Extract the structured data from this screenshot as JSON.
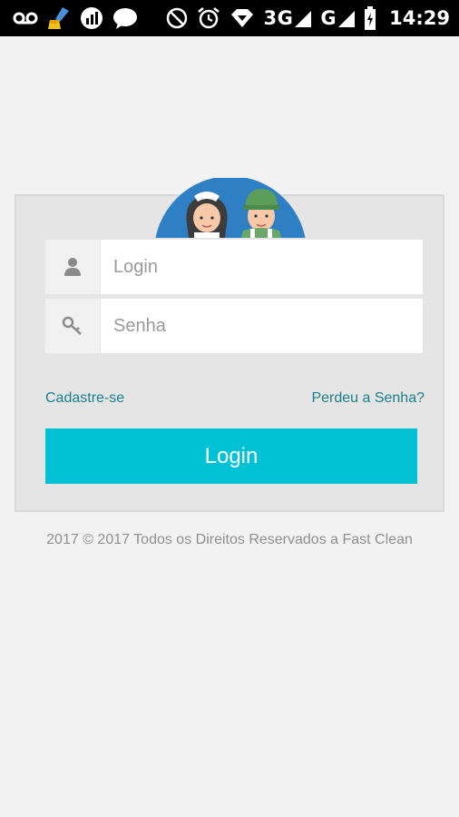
{
  "status_bar": {
    "network_3g": "3G",
    "network_g": "G",
    "time": "14:29",
    "icons": [
      "voicemail-icon",
      "cleaner-app-icon",
      "stats-icon",
      "chat-icon",
      "do-not-disturb-icon",
      "alarm-icon",
      "wifi-diamond-icon",
      "signal-icon",
      "battery-icon"
    ]
  },
  "login_form": {
    "login_placeholder": "Login",
    "password_placeholder": "Senha",
    "register_link": "Cadastre-se",
    "forgot_link": "Perdeu a Senha?",
    "submit_label": "Login"
  },
  "footer": {
    "text": "2017 © 2017 Todos os Direitos Reservados a Fast Clean"
  },
  "colors": {
    "accent": "#00c2d4",
    "link": "#1a7f8a",
    "avatar_circle": "#2e7fc4",
    "worker_cap": "#5a9e5a"
  }
}
